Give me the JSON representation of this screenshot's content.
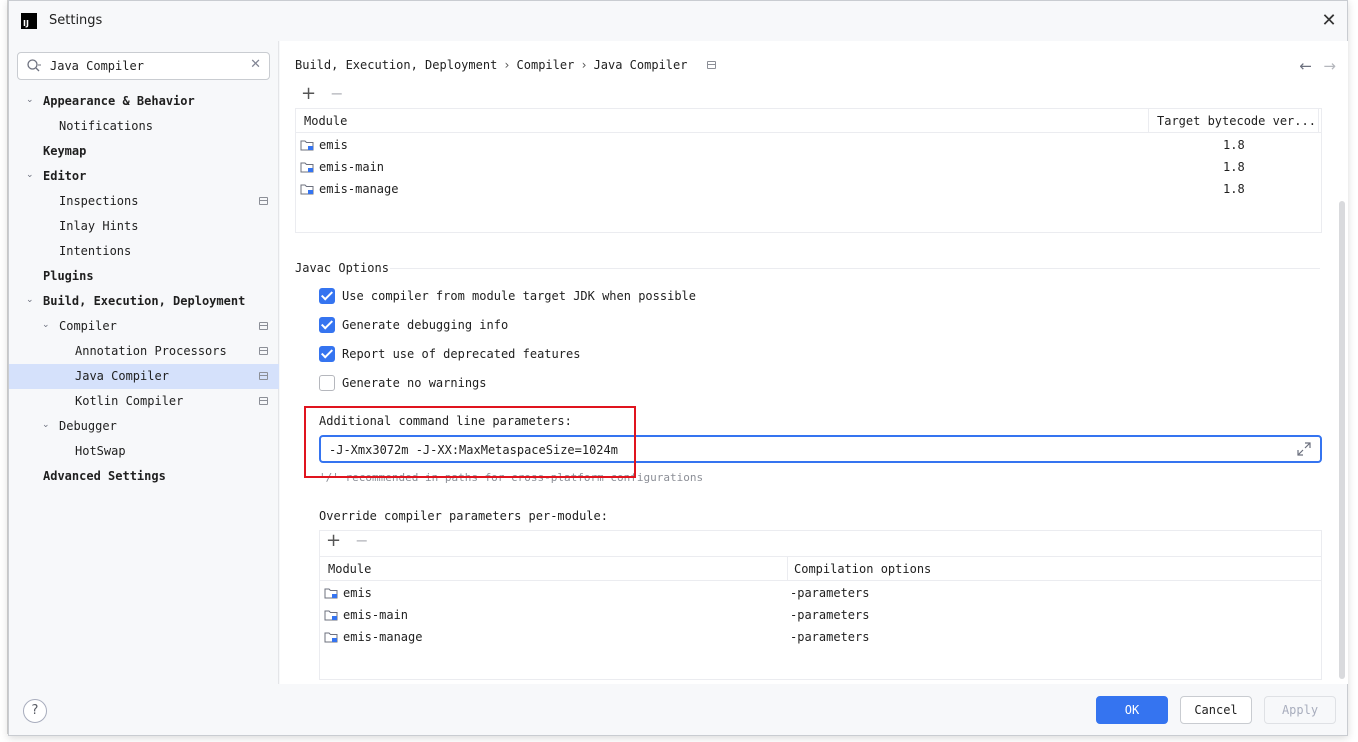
{
  "window": {
    "title": "Settings",
    "logo_text": "IJ"
  },
  "search": {
    "value": "Java Compiler"
  },
  "sidebar": {
    "items": [
      {
        "label": "Appearance & Behavior",
        "bold": true,
        "arrow": "expanded"
      },
      {
        "label": "Notifications",
        "bold": false
      },
      {
        "label": "Keymap",
        "bold": true
      },
      {
        "label": "Editor",
        "bold": true,
        "arrow": "expanded"
      },
      {
        "label": "Inspections",
        "bold": false,
        "badge": true
      },
      {
        "label": "Inlay Hints",
        "bold": false
      },
      {
        "label": "Intentions",
        "bold": false
      },
      {
        "label": "Plugins",
        "bold": true
      },
      {
        "label": "Build, Execution, Deployment",
        "bold": true,
        "arrow": "expanded"
      },
      {
        "label": "Compiler",
        "bold": false,
        "arrow": "expanded",
        "badge": true
      },
      {
        "label": "Annotation Processors",
        "bold": false,
        "badge": true
      },
      {
        "label": "Java Compiler",
        "bold": false,
        "badge": true,
        "selected": true
      },
      {
        "label": "Kotlin Compiler",
        "bold": false,
        "badge": true
      },
      {
        "label": "Debugger",
        "bold": false,
        "arrow": "expanded"
      },
      {
        "label": "HotSwap",
        "bold": false
      },
      {
        "label": "Advanced Settings",
        "bold": true
      }
    ]
  },
  "breadcrumb": {
    "items": [
      "Build, Execution, Deployment",
      "Compiler",
      "Java Compiler"
    ],
    "separator": "›"
  },
  "bytecode_table": {
    "headers": [
      "Module",
      "Target bytecode ver..."
    ],
    "rows": [
      {
        "module": "emis",
        "version": "1.8"
      },
      {
        "module": "emis-main",
        "version": "1.8"
      },
      {
        "module": "emis-manage",
        "version": "1.8"
      }
    ]
  },
  "javac": {
    "section_title": "Javac Options",
    "options": [
      {
        "label": "Use compiler from module target JDK when possible",
        "checked": true
      },
      {
        "label": "Generate debugging info",
        "checked": true
      },
      {
        "label": "Report use of deprecated features",
        "checked": true
      },
      {
        "label": "Generate no warnings",
        "checked": false
      }
    ],
    "additional_label": "Additional command line parameters:",
    "additional_value": "-J-Xmx3072m -J-XX:MaxMetaspaceSize=1024m",
    "hint": "'/' recommended in paths for cross-platform configurations",
    "override_label": "Override compiler parameters per-module:"
  },
  "override_table": {
    "headers": [
      "Module",
      "Compilation options"
    ],
    "rows": [
      {
        "module": "emis",
        "options": "-parameters"
      },
      {
        "module": "emis-main",
        "options": "-parameters"
      },
      {
        "module": "emis-manage",
        "options": "-parameters"
      }
    ]
  },
  "footer": {
    "help": "?",
    "ok": "OK",
    "cancel": "Cancel",
    "apply": "Apply"
  },
  "colors": {
    "accent": "#3574f0",
    "selection": "#d5e1fb",
    "highlight": "#e0141e"
  }
}
